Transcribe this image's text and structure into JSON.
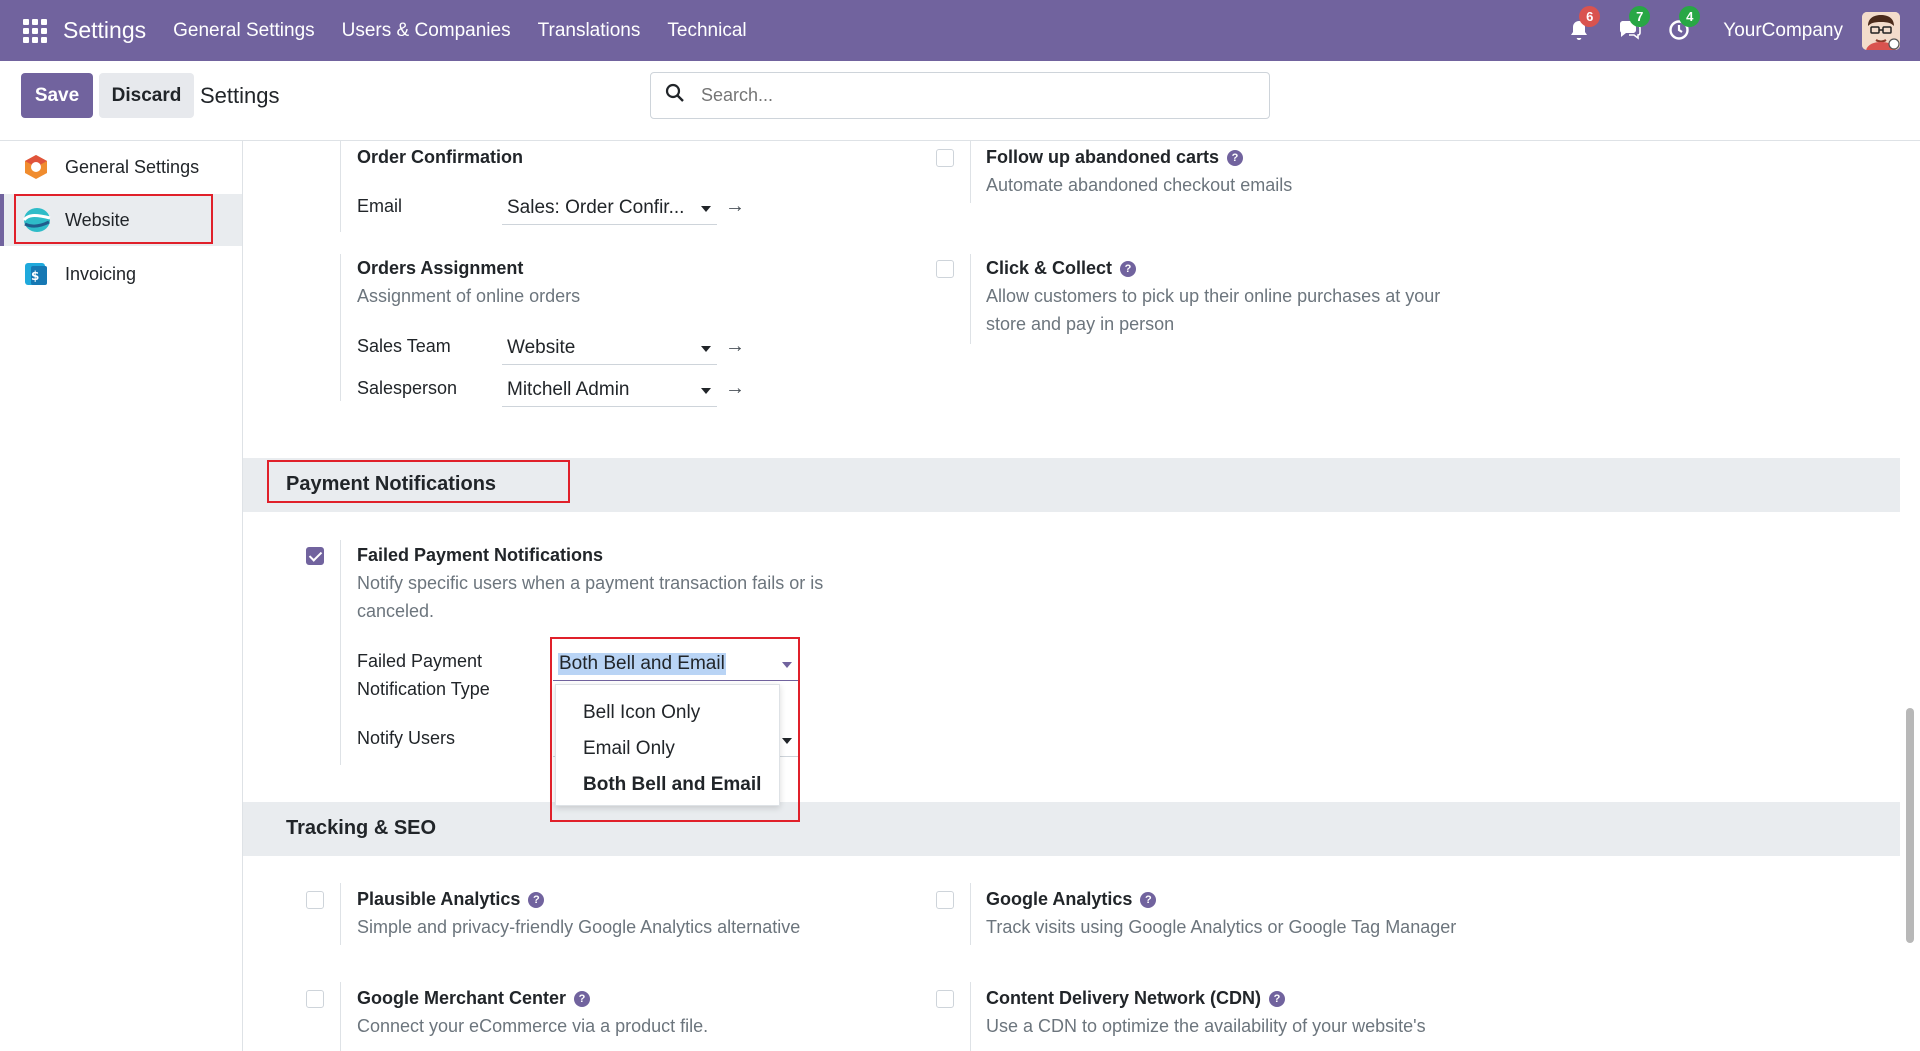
{
  "navbar": {
    "brand": "Settings",
    "menu": [
      "General Settings",
      "Users & Companies",
      "Translations",
      "Technical"
    ],
    "activity_count": "6",
    "messages_count": "7",
    "activities_count": "4",
    "company": "YourCompany"
  },
  "control": {
    "save_label": "Save",
    "discard_label": "Discard",
    "title": "Settings",
    "search_placeholder": "Search..."
  },
  "sidebar": {
    "items": [
      {
        "label": "General Settings"
      },
      {
        "label": "Website"
      },
      {
        "label": "Invoicing"
      }
    ]
  },
  "content": {
    "order_confirmation": {
      "title": "Order Confirmation",
      "email_label": "Email",
      "email_value": "Sales: Order Confir..."
    },
    "follow_up": {
      "title": "Follow up abandoned carts",
      "desc": "Automate abandoned checkout emails"
    },
    "orders_assignment": {
      "title": "Orders Assignment",
      "desc": "Assignment of online orders",
      "sales_team_label": "Sales Team",
      "sales_team_value": "Website",
      "salesperson_label": "Salesperson",
      "salesperson_value": "Mitchell Admin"
    },
    "click_collect": {
      "title": "Click & Collect",
      "desc_line1": "Allow customers to pick up their online purchases at your",
      "desc_line2": "store and pay in person"
    },
    "payment_section": {
      "title": "Payment Notifications",
      "failed_title": "Failed Payment Notifications",
      "failed_desc_line1": "Notify specific users when a payment transaction fails or is",
      "failed_desc_line2": "canceled.",
      "type_label_line1": "Failed Payment",
      "type_label_line2": "Notification Type",
      "type_value": "Both Bell and Email",
      "notify_users_label": "Notify Users",
      "options": [
        "Bell Icon Only",
        "Email Only",
        "Both Bell and Email"
      ]
    },
    "tracking_section": {
      "title": "Tracking & SEO",
      "plausible_title": "Plausible Analytics",
      "plausible_desc": "Simple and privacy-friendly Google Analytics alternative",
      "google_title": "Google Analytics",
      "google_desc": "Track visits using Google Analytics or Google Tag Manager",
      "merchant_title": "Google Merchant Center",
      "merchant_desc": "Connect your eCommerce via a product file.",
      "cdn_title": "Content Delivery Network (CDN)",
      "cdn_desc": "Use a CDN to optimize the availability of your website's"
    }
  },
  "colors": {
    "brand": "#71639e",
    "highlight_box": "#e0202a",
    "selection": "#b9d4f5"
  }
}
